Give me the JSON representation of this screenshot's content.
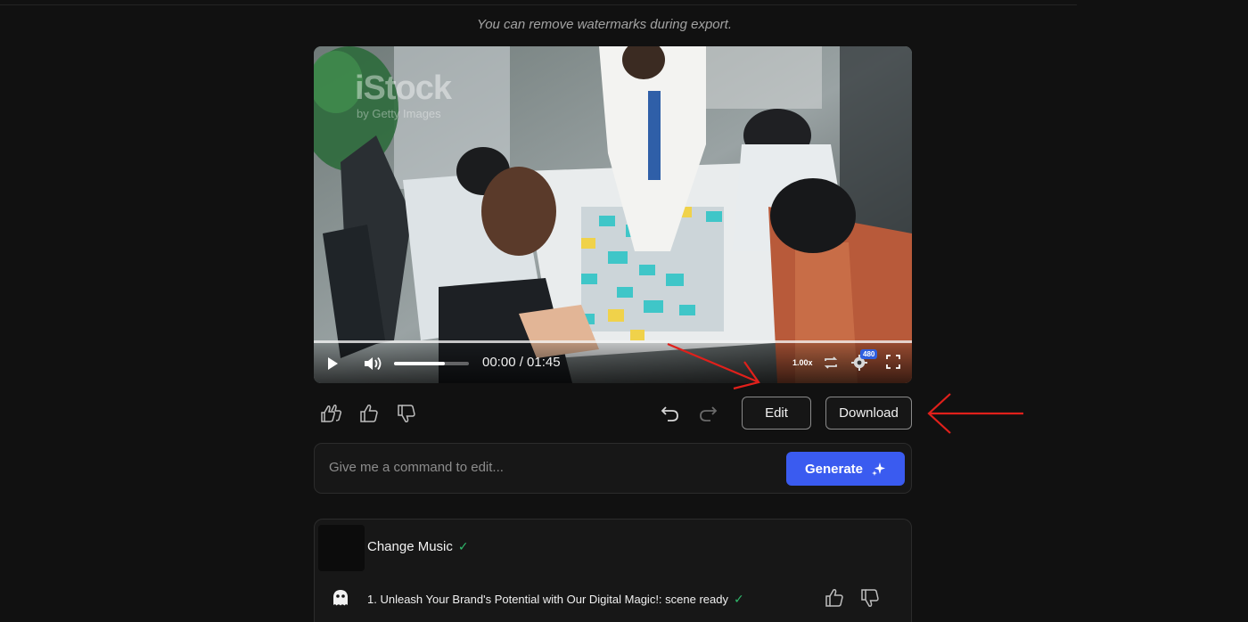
{
  "notice": "You can remove watermarks during export.",
  "video": {
    "watermark": "iStock",
    "watermark_sub": "by Getty Images",
    "time": "00:00 / 01:45",
    "speed": "1.00x",
    "quality": "480",
    "volume_level": 0.68,
    "progress": 0
  },
  "actions": {
    "edit_label": "Edit",
    "download_label": "Download"
  },
  "command": {
    "placeholder": "Give me a command to edit...",
    "generate_label": "Generate"
  },
  "history": {
    "title": "Change Music",
    "scene_text": "1. Unleash Your Brand's Potential with Our Digital Magic!: scene ready"
  },
  "colors": {
    "background": "#111111",
    "accent": "#3a5bf0",
    "success": "#2fb86b",
    "annotation": "#e0201b"
  },
  "icons": [
    "play-icon",
    "volume-icon",
    "loop-icon",
    "settings-icon",
    "fullscreen-icon",
    "double-thumbs-up-icon",
    "thumbs-up-icon",
    "thumbs-down-icon",
    "undo-icon",
    "redo-icon",
    "sparkle-icon",
    "check-icon",
    "bot-icon"
  ]
}
